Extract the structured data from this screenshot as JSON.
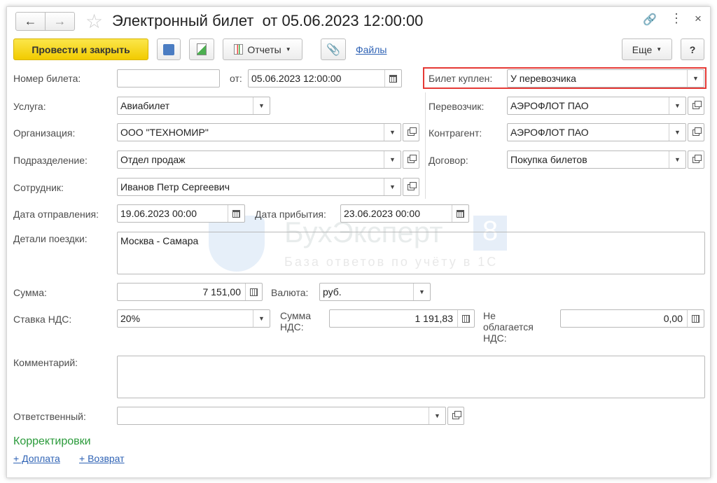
{
  "title": "Электронный билет  от 05.06.2023 12:00:00",
  "toolbar": {
    "post_close": "Провести и закрыть",
    "reports": "Отчеты",
    "files": "Файлы",
    "more": "Еще",
    "help": "?"
  },
  "fields": {
    "ticket_number": {
      "label": "Номер билета:",
      "value": ""
    },
    "date": {
      "label": "от:",
      "value": "05.06.2023 12:00:00"
    },
    "bought": {
      "label": "Билет куплен:",
      "value": "У перевозчика"
    },
    "service": {
      "label": "Услуга:",
      "value": "Авиабилет"
    },
    "carrier": {
      "label": "Перевозчик:",
      "value": "АЭРОФЛОТ ПАО"
    },
    "organization": {
      "label": "Организация:",
      "value": "ООО \"ТЕХНОМИР\""
    },
    "counterparty": {
      "label": "Контрагент:",
      "value": "АЭРОФЛОТ ПАО"
    },
    "department": {
      "label": "Подразделение:",
      "value": "Отдел продаж"
    },
    "contract": {
      "label": "Договор:",
      "value": "Покупка билетов"
    },
    "employee": {
      "label": "Сотрудник:",
      "value": "Иванов Петр Сергеевич"
    },
    "departure": {
      "label": "Дата отправления:",
      "value": "19.06.2023 00:00"
    },
    "arrival": {
      "label": "Дата прибытия:",
      "value": "23.06.2023 00:00"
    },
    "trip_details": {
      "label": "Детали поездки:",
      "value": "Москва - Самара"
    },
    "amount": {
      "label": "Сумма:",
      "value": "7 151,00"
    },
    "currency": {
      "label": "Валюта:",
      "value": "руб."
    },
    "vat_rate": {
      "label": "Ставка НДС:",
      "value": "20%"
    },
    "vat_amount": {
      "label": "Сумма НДС:",
      "value": "1 191,83"
    },
    "vat_exempt": {
      "label": "Не облагается НДС:",
      "value": "0,00"
    },
    "comment": {
      "label": "Комментарий:",
      "value": ""
    },
    "responsible": {
      "label": "Ответственный:",
      "value": ""
    }
  },
  "corrections": {
    "title": "Корректировки",
    "surcharge": "+ Доплата",
    "refund": "+ Возврат"
  },
  "watermark": {
    "brand": "БухЭксперт",
    "badge": "8",
    "tagline": "База ответов по учёту в 1С"
  }
}
